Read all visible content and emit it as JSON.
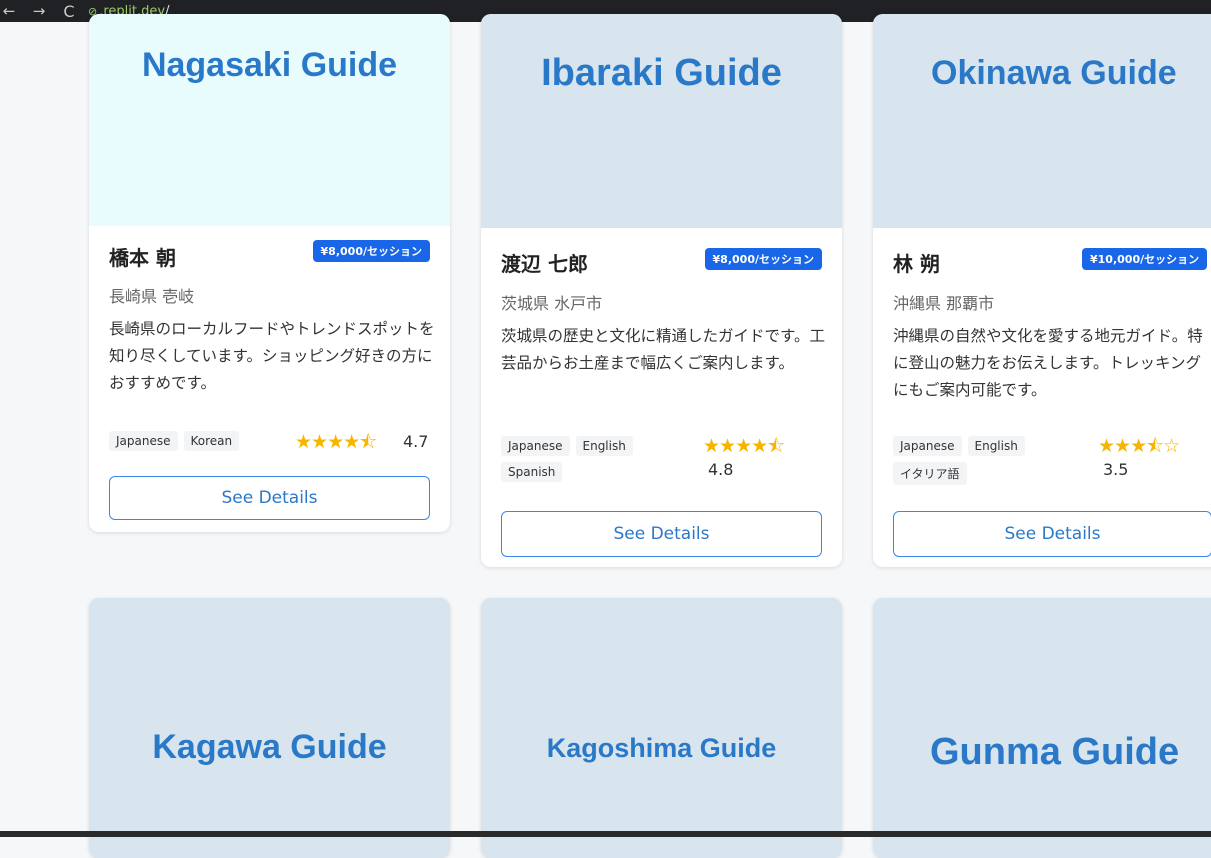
{
  "browser": {
    "back": "←",
    "forward": "→",
    "reload": "C",
    "url": ".replit.dev",
    "url_suffix": "/"
  },
  "cards": [
    {
      "guide": "Nagasaki Guide",
      "name": "橋本 朝",
      "price": "¥8,000/セッション",
      "location": "長崎県 壱岐",
      "description": "長崎県のローカルフードやトレンドスポットを知り尽くしています。ショッピング好きの方におすすめです。",
      "languages": [
        "Japanese",
        "Korean"
      ],
      "stars": "★★★★⯪",
      "rating": "4.7",
      "button": "See Details",
      "banner_color": "#e8fbfd"
    },
    {
      "guide": "Ibaraki Guide",
      "name": "渡辺 七郎",
      "price": "¥8,000/セッション",
      "location": "茨城県 水戸市",
      "description": "茨城県の歴史と文化に精通したガイドです。工芸品からお土産まで幅広くご案内します。",
      "languages": [
        "Japanese",
        "English",
        "Spanish"
      ],
      "stars": "★★★★⯪",
      "rating": "4.8",
      "button": "See Details",
      "banner_color": "#d8e5ee"
    },
    {
      "guide": "Okinawa Guide",
      "name": "林 朔",
      "price": "¥10,000/セッション",
      "location": "沖縄県 那覇市",
      "description": "沖縄県の自然や文化を愛する地元ガイド。特に登山の魅力をお伝えします。トレッキングにもご案内可能です。",
      "languages": [
        "Japanese",
        "English",
        "イタリア語"
      ],
      "stars": "★★★⯪☆",
      "rating": "3.5",
      "button": "See Details",
      "banner_color": "#d8e5ee"
    }
  ],
  "bottom_cards": [
    {
      "guide": "Kagawa Guide"
    },
    {
      "guide": "Kagoshima Guide"
    },
    {
      "guide": "Gunma Guide"
    }
  ]
}
